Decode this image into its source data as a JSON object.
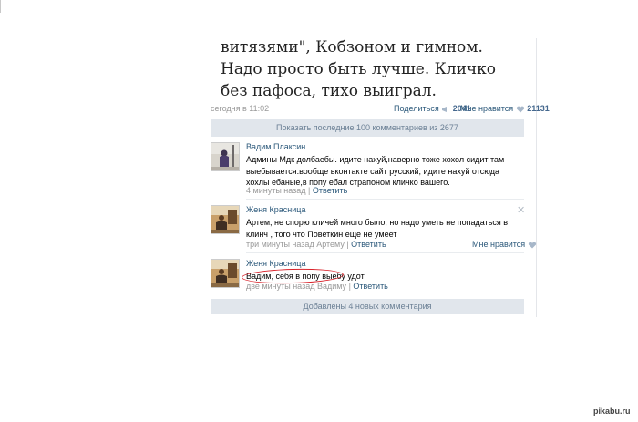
{
  "post": {
    "lines": [
      "витязями\", Кобзоном и гимном.",
      "Надо просто быть лучше. Кличко",
      "без пафоса, тихо выиграл."
    ],
    "time": "сегодня в 11:02",
    "share_label": "Поделиться",
    "share_count": "2041",
    "like_label": "Мне нравится",
    "like_count": "21131"
  },
  "show_more_label": "Показать последние 100 комментариев из 2677",
  "comments": [
    {
      "author": "Вадим Плаксин",
      "text": "Админы Мдк долбаебы. идите нахуй,наверно тоже хохол сидит там выебывается.вообще вконтакте сайт русский, идите нахуй отсюда хохлы ебаные,в попу ебал страпоном кличко вашего.",
      "time": "4 минуты назад",
      "reply": "Ответить"
    },
    {
      "author": "Женя Красница",
      "text": "Артем, не спорю кличей много было, но надо уметь не попадаться в клинч , того что Поветкин еще не умеет",
      "time": "три минуты назад Артему",
      "reply": "Ответить",
      "like_label": "Мне нравится"
    },
    {
      "author": "Женя Красница",
      "text": "Вадим, себя в попу выебу удот",
      "time": "две минуты назад Вадиму",
      "reply": "Ответить"
    }
  ],
  "added_label": "Добавлены 4 новых комментария",
  "watermark": "pikabu.ru",
  "colors": {
    "link": "#2b587a",
    "bar": "#e1e6ec",
    "highlight": "#d9232b"
  }
}
